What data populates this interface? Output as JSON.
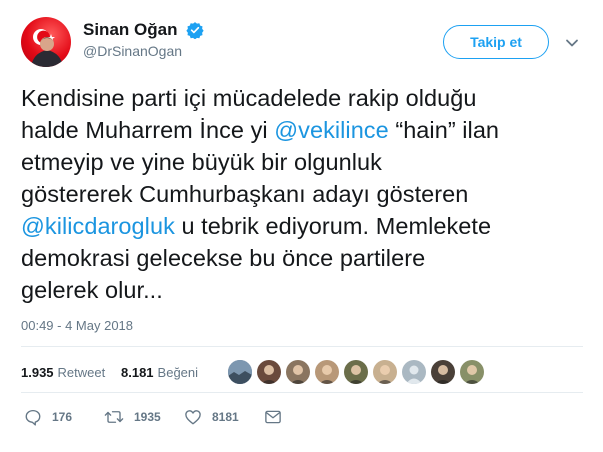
{
  "user": {
    "name": "Sinan Oğan",
    "handle": "@DrSinanOgan",
    "avatar_bg": "#e30a17"
  },
  "follow_button": {
    "label": "Takip et"
  },
  "tweet": {
    "lines": [
      [
        {
          "text": "Kendisine parti içi mücadelede rakip olduğu"
        }
      ],
      [
        {
          "text": "halde Muharrem İnce yi "
        },
        {
          "text": "@vekilince",
          "mention": true
        },
        {
          "text": " “hain” ilan"
        }
      ],
      [
        {
          "text": "etmeyip ve yine büyük bir olgunluk"
        }
      ],
      [
        {
          "text": "göstererek Cumhurbaşkanı adayı gösteren"
        }
      ],
      [
        {
          "text": "@kilicdarogluk",
          "mention": true
        },
        {
          "text": " u tebrik ediyorum. Memlekete"
        }
      ],
      [
        {
          "text": "demokrasi gelecekse bu önce partilere"
        }
      ],
      [
        {
          "text": "gelerek olur..."
        }
      ]
    ],
    "timestamp": "00:49 - 4 May 2018"
  },
  "stats": {
    "retweets_count": "1.935",
    "retweets_label": "Retweet",
    "likes_count": "8.181",
    "likes_label": "Beğeni"
  },
  "likers": [
    {
      "icon": "landscape-avatar",
      "bg": "#5a7590"
    },
    {
      "icon": "person-avatar",
      "bg": "#6a4a3c"
    },
    {
      "icon": "person-avatar",
      "bg": "#8a7560"
    },
    {
      "icon": "person-avatar",
      "bg": "#b89878"
    },
    {
      "icon": "person-avatar",
      "bg": "#6b6e4a"
    },
    {
      "icon": "person-avatar",
      "bg": "#c8b090"
    },
    {
      "icon": "default-egg-avatar",
      "bg": "#aab8c2"
    },
    {
      "icon": "person-avatar",
      "bg": "#4a4038"
    },
    {
      "icon": "person-avatar",
      "bg": "#889068"
    }
  ],
  "actions": {
    "reply_count": "176",
    "retweet_count": "1935",
    "like_count": "8181"
  },
  "colors": {
    "accent": "#1da1f2",
    "mention": "#1b95e0",
    "secondary_text": "#657786",
    "divider": "#e6ecf0"
  }
}
